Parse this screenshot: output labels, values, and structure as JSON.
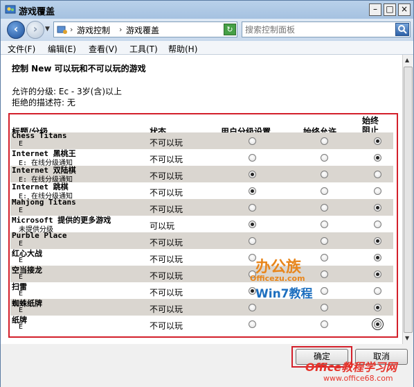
{
  "window": {
    "title": "游戏覆盖"
  },
  "address": {
    "crumbs": [
      "游戏控制",
      "游戏覆盖"
    ]
  },
  "search": {
    "placeholder": "搜索控制面板"
  },
  "menu": [
    "文件(F)",
    "编辑(E)",
    "查看(V)",
    "工具(T)",
    "帮助(H)"
  ],
  "page": {
    "heading": "控制 New 可以玩和不可以玩的游戏",
    "allowed_rating": "允许的分级: Ec - 3岁(含)以上",
    "blocked_descriptors": "拒绝的描述符: 无"
  },
  "table": {
    "headers": {
      "title": "标题/分级",
      "status": "状态",
      "user_setting": "用户分级设置",
      "always_allow": "始终允许",
      "always_block": "始终阻止"
    },
    "rows": [
      {
        "name": "Chess Titans",
        "rating": "E",
        "status": "不可以玩",
        "selected": "block"
      },
      {
        "name": "Internet 黑桃王",
        "rating": "E: 在线分级通知",
        "status": "不可以玩",
        "selected": "block"
      },
      {
        "name": "Internet 双陆棋",
        "rating": "E: 在线分级通知",
        "status": "不可以玩",
        "selected": "user"
      },
      {
        "name": "Internet 跳棋",
        "rating": "E: 在线分级通知",
        "status": "不可以玩",
        "selected": "user"
      },
      {
        "name": "Mahjong Titans",
        "rating": "E",
        "status": "不可以玩",
        "selected": "block"
      },
      {
        "name": "Microsoft 提供的更多游戏",
        "rating": "未提供分级",
        "status": "可以玩",
        "selected": "user"
      },
      {
        "name": "Purble Place",
        "rating": "E",
        "status": "不可以玩",
        "selected": "block"
      },
      {
        "name": "红心大战",
        "rating": "E",
        "status": "不可以玩",
        "selected": "block"
      },
      {
        "name": "空当接龙",
        "rating": "E",
        "status": "不可以玩",
        "selected": "block"
      },
      {
        "name": "扫雷",
        "rating": "E",
        "status": "不可以玩",
        "selected": "user"
      },
      {
        "name": "蜘蛛纸牌",
        "rating": "E",
        "status": "不可以玩",
        "selected": "block"
      },
      {
        "name": "纸牌",
        "rating": "E",
        "status": "不可以玩",
        "selected": "block"
      }
    ]
  },
  "buttons": {
    "ok": "确定",
    "cancel": "取消"
  },
  "watermarks": {
    "w1_a": "办公族",
    "w1_b": "Officezu.com",
    "w1_c": "Win7教程",
    "w2_a": "Office教程学习网",
    "w2_b": "www.office68.com"
  },
  "colors": {
    "highlight": "#d31f2a",
    "row_shade": "#dad6d0"
  }
}
